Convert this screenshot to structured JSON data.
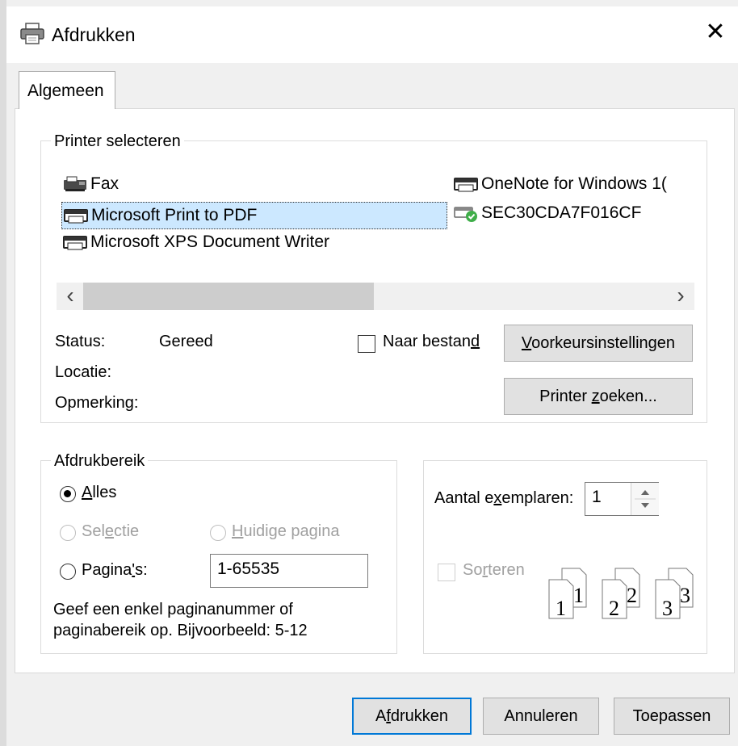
{
  "window": {
    "title": "Afdrukken",
    "close_glyph": "✕"
  },
  "tabs": [
    {
      "label": "Algemeen",
      "selected": true
    }
  ],
  "printer_group": {
    "legend": "Printer selecteren",
    "printers": [
      {
        "name": "Fax",
        "icon": "fax-printer-icon"
      },
      {
        "name": "Microsoft Print to PDF",
        "icon": "printer-icon",
        "selected": true
      },
      {
        "name": "Microsoft XPS Document Writer",
        "icon": "printer-icon"
      },
      {
        "name": "OneNote for Windows 1(",
        "icon": "printer-icon"
      },
      {
        "name": "SEC30CDA7F016CF",
        "icon": "default-printer-icon"
      }
    ],
    "scroll_left": "‹",
    "scroll_right": "›",
    "scroll_position": 0.0,
    "status_label": "Status:",
    "status_value": "Gereed",
    "location_label": "Locatie:",
    "comment_label": "Opmerking:",
    "to_file_label_pre": "Naar bestan",
    "to_file_label_u": "d",
    "to_file_checked": false,
    "preferences_button_u": "V",
    "preferences_button_rest": "oorkeursinstellingen",
    "find_button_pre": "Printer ",
    "find_button_u": "z",
    "find_button_rest": "oeken..."
  },
  "range_group": {
    "legend": "Afdrukbereik",
    "all_u": "A",
    "all_rest": "lles",
    "selection_pre": "Sel",
    "selection_u": "e",
    "selection_rest": "ctie",
    "current_u": "H",
    "current_rest": "uidige pagina",
    "pages_pre": "Pagina",
    "pages_u": "'",
    "pages_rest": "s:",
    "pages_value": "1-65535",
    "hint_line1": "Geef een enkel paginanummer of",
    "hint_line2": "paginabereik op. Bijvoorbeeld: 5-12"
  },
  "copies_group": {
    "copies_pre": "Aantal e",
    "copies_u": "x",
    "copies_rest": "emplaren:",
    "copies_value": "1",
    "collate_pre": "So",
    "collate_u": "r",
    "collate_rest": "teren",
    "collate_checked": false,
    "collate_pages": [
      {
        "front": "1",
        "back": "1"
      },
      {
        "front": "2",
        "back": "2"
      },
      {
        "front": "3",
        "back": "3"
      }
    ]
  },
  "buttons": {
    "print_pre": "A",
    "print_u": "f",
    "print_rest": "drukken",
    "cancel": "Annuleren",
    "apply": "Toepassen"
  },
  "colors": {
    "accent": "#0078d7",
    "dialog_bg": "#f0f0f0",
    "disabled": "#a0a0a0",
    "success": "#3fae49"
  }
}
